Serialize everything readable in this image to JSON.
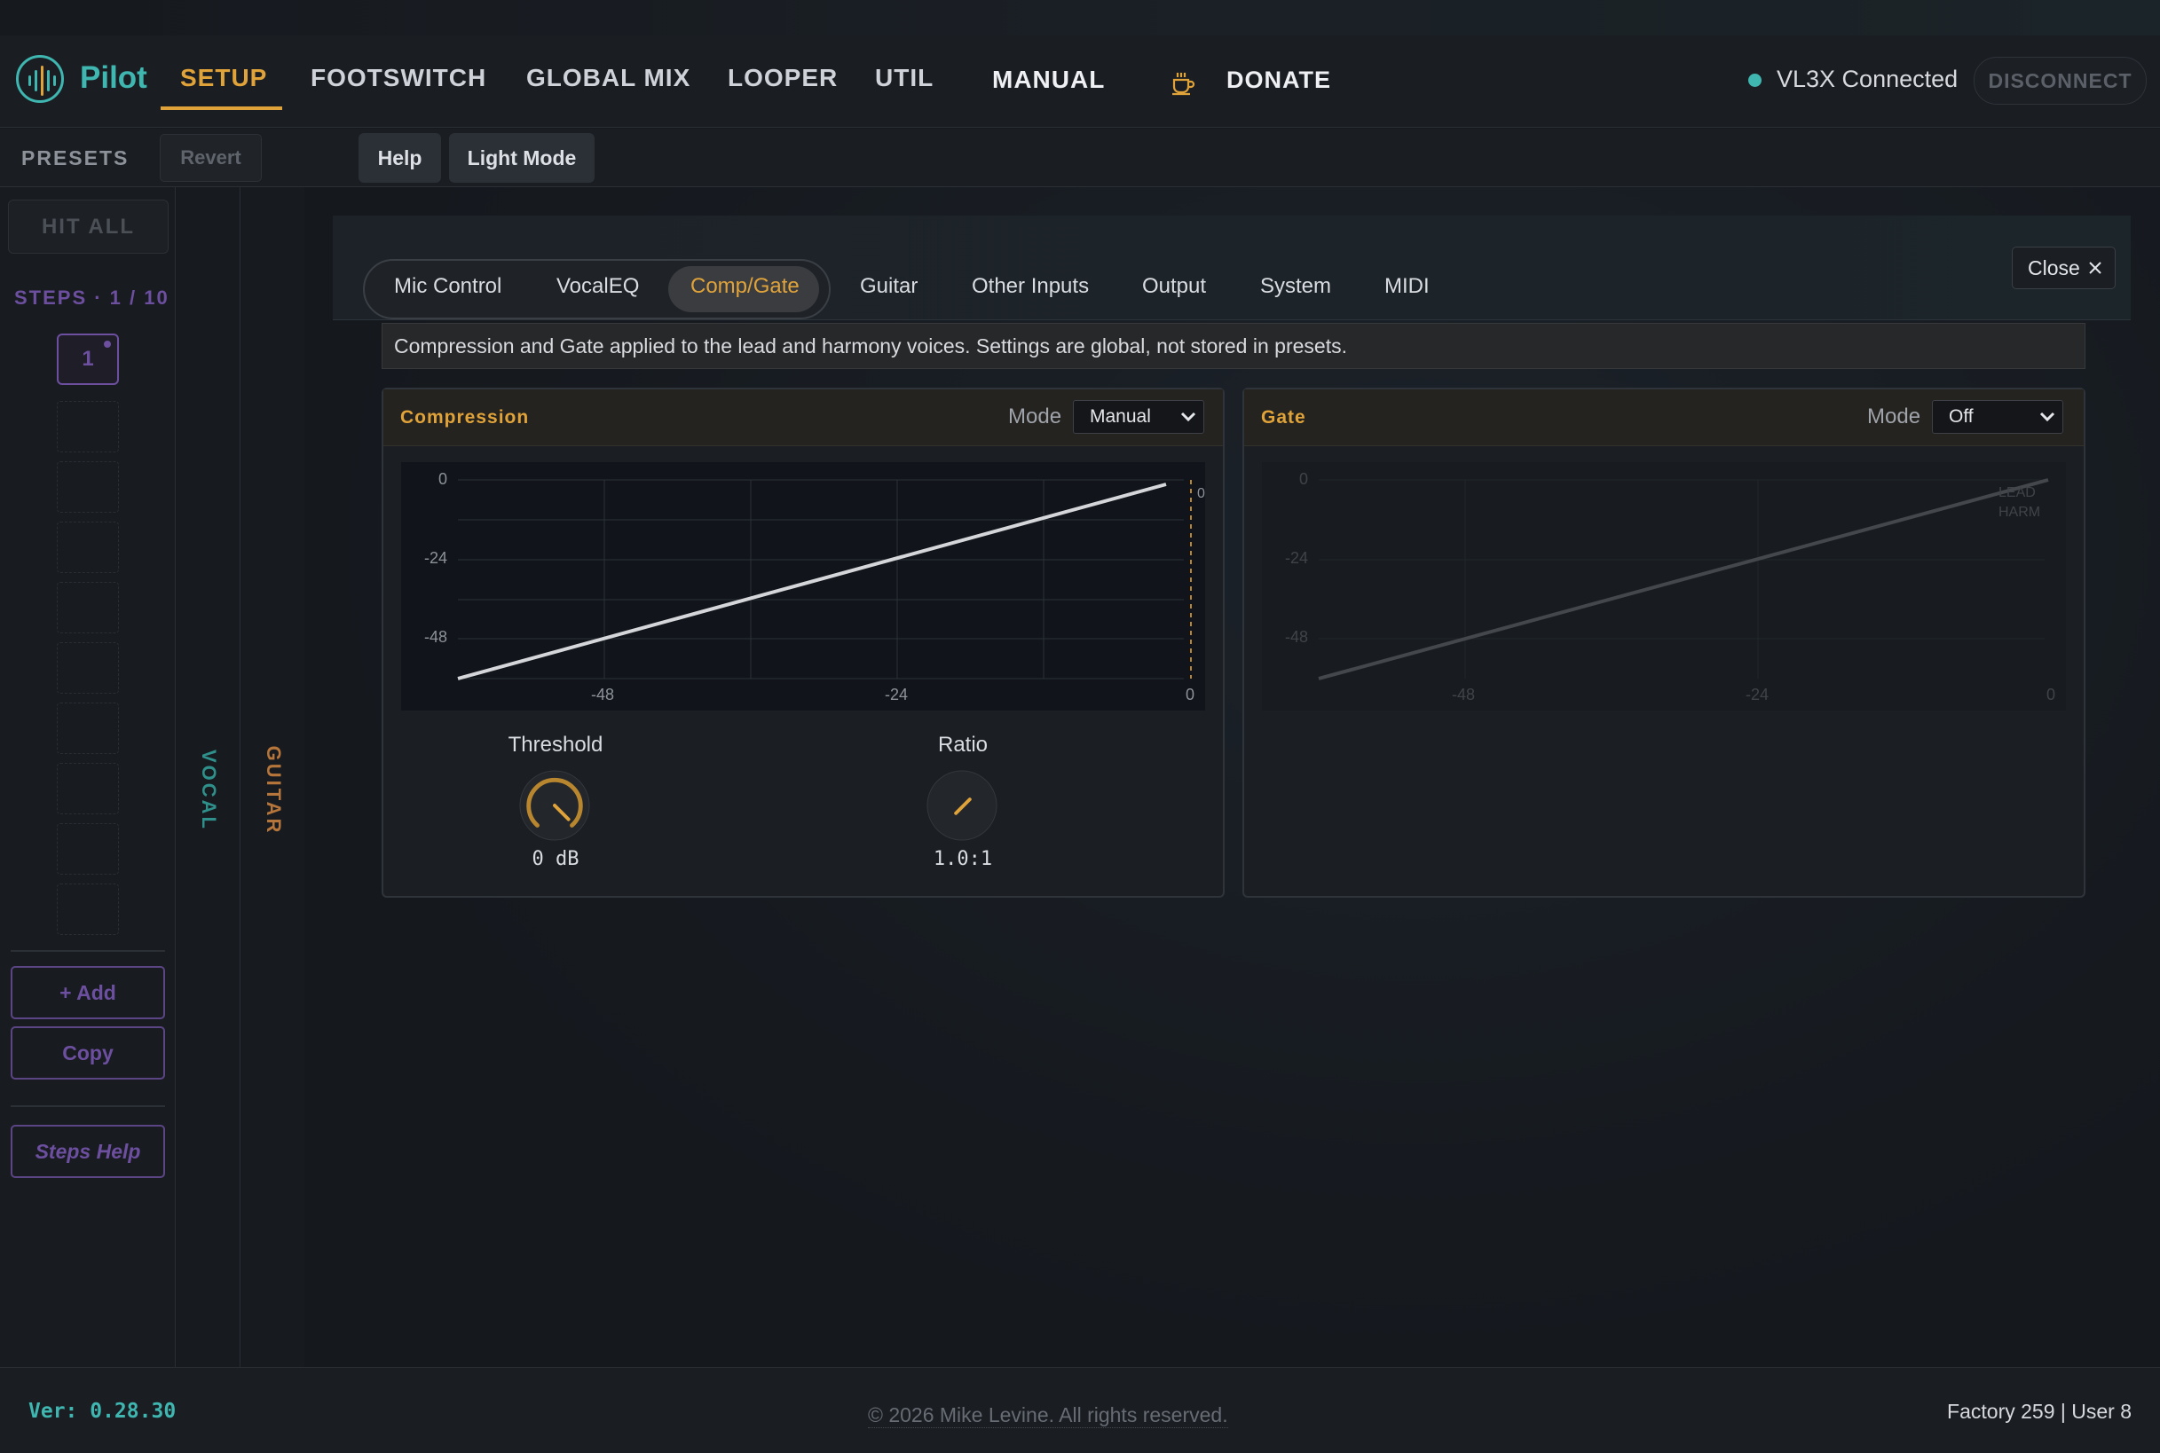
{
  "app": {
    "name": "Pilot"
  },
  "nav": {
    "items": [
      "SETUP",
      "FOOTSWITCH",
      "GLOBAL MIX",
      "LOOPER",
      "UTIL",
      "MANUAL"
    ],
    "donate": "DONATE",
    "connection_status": "VL3X Connected",
    "disconnect": "DISCONNECT"
  },
  "subbar": {
    "presets": "PRESETS",
    "revert": "Revert",
    "help": "Help",
    "light_mode": "Light Mode"
  },
  "steps": {
    "hit_all": "HIT ALL",
    "header": "STEPS · 1 / 10",
    "current_step": "1",
    "add": "+ Add",
    "copy": "Copy",
    "steps_help": "Steps Help"
  },
  "strips": {
    "vocal": "VOCAL",
    "guitar": "GUITAR"
  },
  "panel": {
    "tabs": [
      "Mic Control",
      "VocalEQ",
      "Comp/Gate",
      "Guitar",
      "Other Inputs",
      "Output",
      "System",
      "MIDI"
    ],
    "active_tab": "Comp/Gate",
    "close": "Close",
    "info": "Compression and Gate applied to the lead and harmony voices. Settings are global, not stored in presets."
  },
  "compression": {
    "title": "Compression",
    "mode_label": "Mode",
    "mode_value": "Manual",
    "graph": {
      "y_ticks": [
        "0",
        "-24",
        "-48"
      ],
      "x_ticks": [
        "-48",
        "-24",
        "0"
      ],
      "meter_label": "0"
    },
    "threshold": {
      "label": "Threshold",
      "value": "0 dB"
    },
    "ratio": {
      "label": "Ratio",
      "value": "1.0:1"
    }
  },
  "gate": {
    "title": "Gate",
    "mode_label": "Mode",
    "mode_value": "Off",
    "graph": {
      "y_ticks": [
        "0",
        "-24",
        "-48"
      ],
      "x_ticks": [
        "-48",
        "-24",
        "0"
      ],
      "legend": [
        "LEAD",
        "HARM"
      ]
    }
  },
  "footer": {
    "version": "Ver: 0.28.30",
    "copyright": "© 2026 Mike Levine. All rights reserved.",
    "counts": "Factory 259 | User 8"
  },
  "colors": {
    "accent": "#e0a33a",
    "teal": "#3fb6b0",
    "purple": "#6d4fa0",
    "guitar": "#b6753a"
  }
}
